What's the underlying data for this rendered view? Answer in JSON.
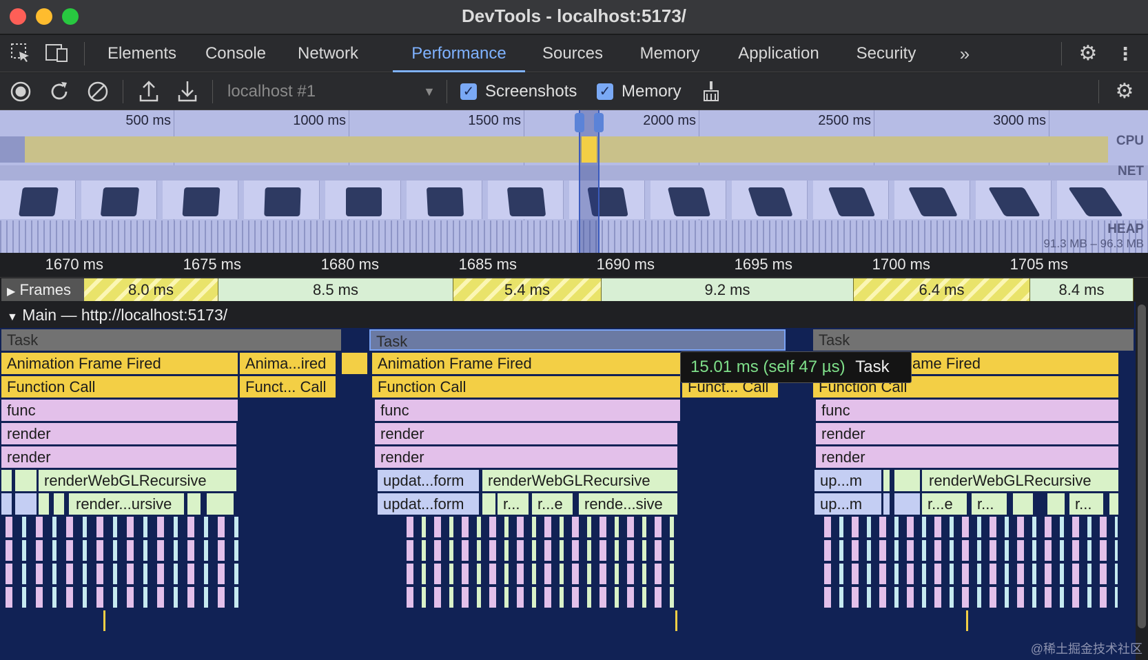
{
  "window": {
    "title": "DevTools - localhost:5173/"
  },
  "tabs": {
    "elements": "Elements",
    "console": "Console",
    "network": "Network",
    "performance": "Performance",
    "sources": "Sources",
    "memory": "Memory",
    "application": "Application",
    "security": "Security"
  },
  "toolbar": {
    "target": "localhost #1",
    "screenshots_label": "Screenshots",
    "memory_label": "Memory",
    "screenshots_checked": true,
    "memory_checked": true
  },
  "overview": {
    "ticks": [
      "500 ms",
      "1000 ms",
      "1500 ms",
      "2000 ms",
      "2500 ms",
      "3000 ms"
    ],
    "cpu_label": "CPU",
    "net_label": "NET",
    "heap_label": "HEAP",
    "heap_range": "91.3 MB – 96.3 MB"
  },
  "ruler": {
    "ticks": [
      "1670 ms",
      "1675 ms",
      "1680 ms",
      "1685 ms",
      "1690 ms",
      "1695 ms",
      "1700 ms",
      "1705 ms"
    ]
  },
  "frames": {
    "label": "Frames",
    "items": [
      "8.0 ms",
      "8.5 ms",
      "5.4 ms",
      "9.2 ms",
      "6.4 ms",
      "8.4 ms"
    ]
  },
  "main": {
    "header": "Main — http://localhost:5173/",
    "task": "Task",
    "animation_frame_fired": "Animation Frame Fired",
    "anima_ired": "Anima...ired",
    "ame_fired": "ame Fired",
    "function_call": "Function Call",
    "funct_call": "Funct... Call",
    "func": "func",
    "render": "render",
    "render_webgl_recursive": "renderWebGLRecursive",
    "render_ursive": "render...ursive",
    "updat_form": "updat...form",
    "r_dots": "r...",
    "r_e": "r...e",
    "rende_sive": "rende...sive",
    "up_m": "up...m"
  },
  "tooltip": {
    "duration": "15.01 ms (self 47 µs)",
    "name": "Task"
  },
  "watermark": "@稀土掘金技术社区",
  "colors": {
    "accent": "#7fb2ff",
    "task": "#727272",
    "animation": "#f3cf45",
    "script": "#e3c0ea",
    "flame_bg": "#112255"
  }
}
